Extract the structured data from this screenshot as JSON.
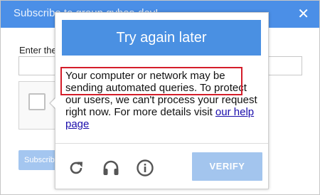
{
  "dialog": {
    "title": "Subscribe to group gvbos-dev!",
    "close_glyph": "✕",
    "form_label": "Enter the",
    "subscribe_label": "Subscribe"
  },
  "challenge": {
    "banner_text": "Try again later",
    "message": "Your computer or network may be sending automated queries. To protect our users, we can't process your request right now. For more details visit",
    "help_link_text": "our help page",
    "verify_label": "VERIFY",
    "icons": {
      "reload": "reload-icon",
      "audio": "headphones-icon",
      "info": "info-icon"
    }
  },
  "colors": {
    "header": "#4b8fe7",
    "banner": "#4a90e2",
    "verify_disabled": "#a3c5ee",
    "highlight": "#d41d2a"
  }
}
